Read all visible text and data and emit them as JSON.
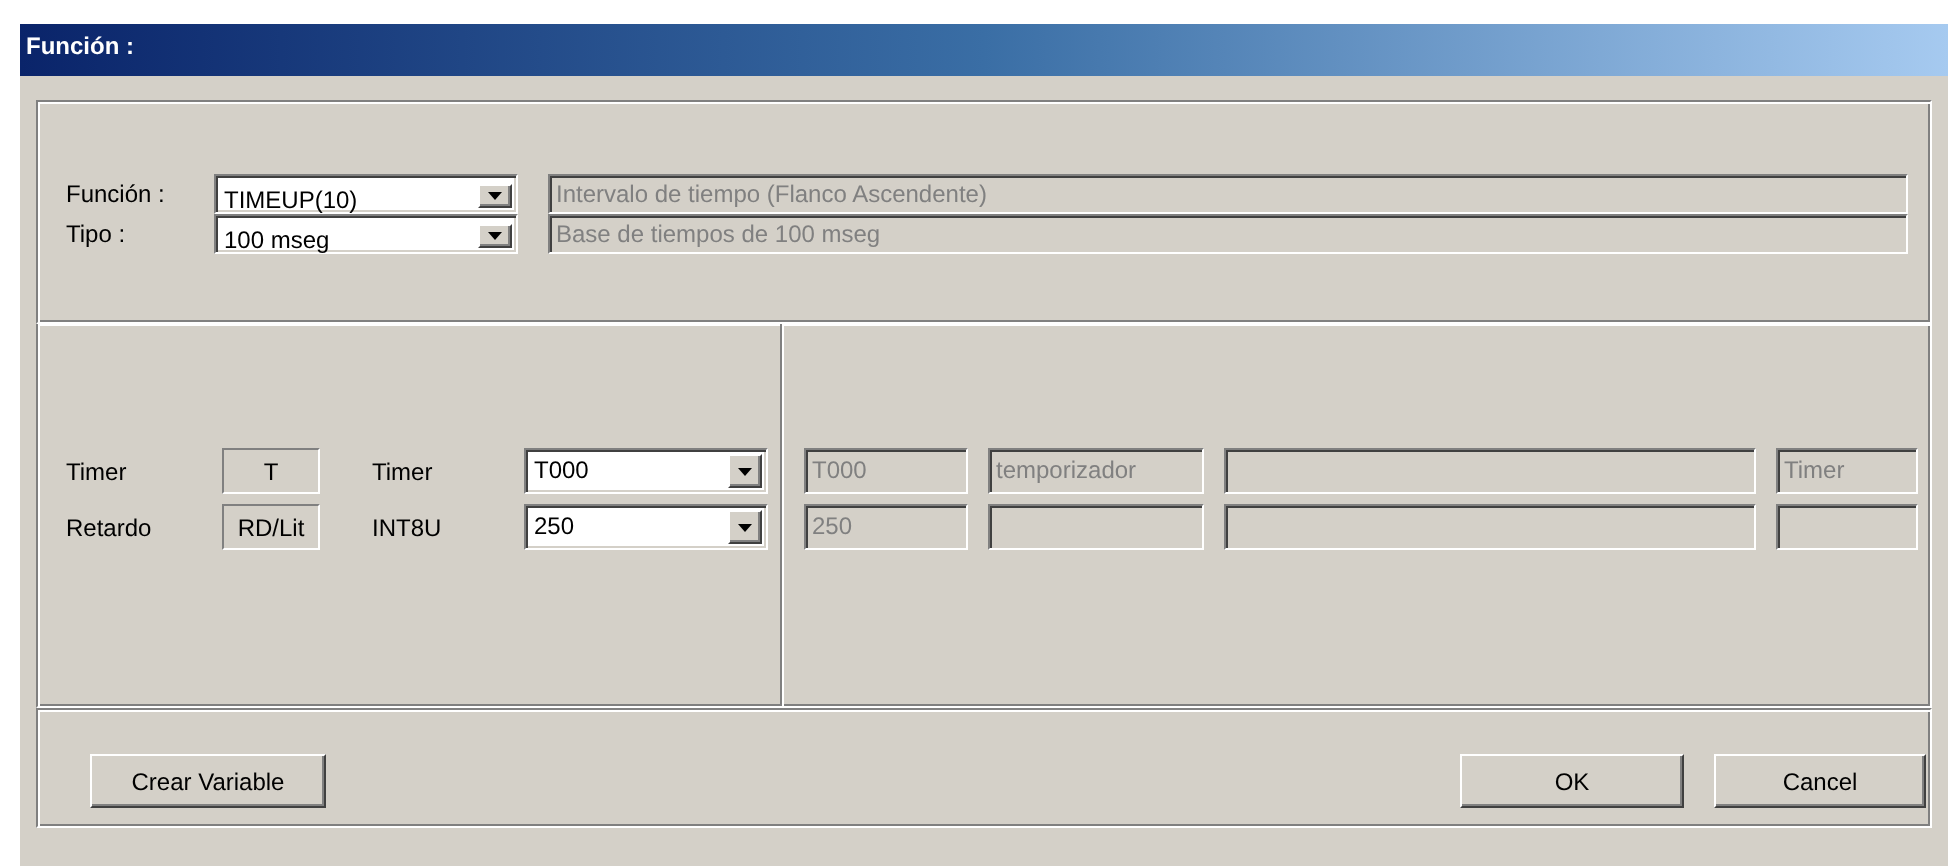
{
  "window": {
    "title": "Función :"
  },
  "function_row": {
    "label": "Función :",
    "value": "TIMEUP(10)",
    "description": "Intervalo de tiempo (Flanco Ascendente)"
  },
  "type_row": {
    "label": "Tipo :",
    "value": "100 mseg",
    "description": "Base de tiempos de 100 mseg"
  },
  "parameters": [
    {
      "label": "Timer",
      "kind_box": "T",
      "type": "Timer",
      "value": "T000",
      "cells": {
        "column_1": "T000",
        "column_2": "temporizador",
        "column_4": "Timer"
      }
    },
    {
      "label": "Retardo",
      "kind_box": "RD/Lit",
      "type": "INT8U",
      "value": "250",
      "cells": {
        "column_1": "250"
      }
    }
  ],
  "buttons": {
    "create": "Crear Variable",
    "ok": "OK",
    "cancel": "Cancel"
  }
}
